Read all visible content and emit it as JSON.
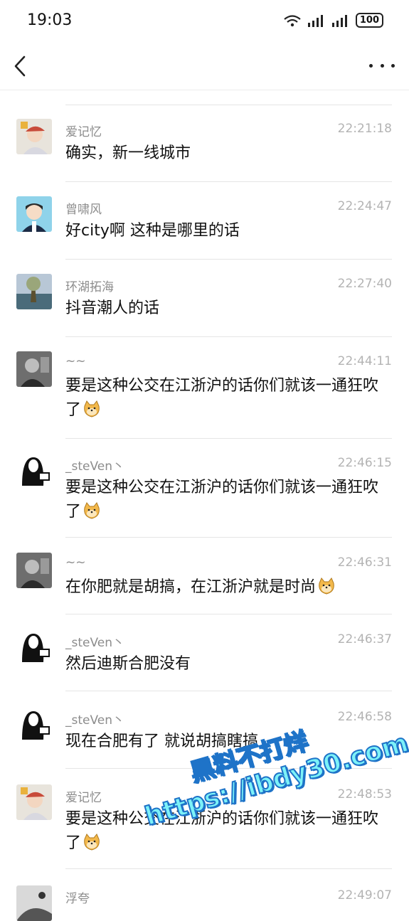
{
  "status_bar": {
    "time": "19:03",
    "battery": "100"
  },
  "nav": {
    "back_icon": "chevron-left-icon",
    "more_icon": "more-dots-icon"
  },
  "messages": [
    {
      "name": "爱记忆",
      "time": "22:21:18",
      "text": "确实，新一线城市",
      "emoji": false
    },
    {
      "name": "曾啸风",
      "time": "22:24:47",
      "text": "好city啊 这种是哪里的话",
      "emoji": false
    },
    {
      "name": "环湖拓海",
      "time": "22:27:40",
      "text": "抖音潮人的话",
      "emoji": false
    },
    {
      "name": "~~",
      "time": "22:44:11",
      "text": "要是这种公交在江浙沪的话你们就该一通狂吹了",
      "emoji": true
    },
    {
      "name": "_steVen丶",
      "time": "22:46:15",
      "text": "要是这种公交在江浙沪的话你们就该一通狂吹了",
      "emoji": true
    },
    {
      "name": "~~",
      "time": "22:46:31",
      "text": "在你肥就是胡搞，在江浙沪就是时尚",
      "emoji": true
    },
    {
      "name": "_steVen丶",
      "time": "22:46:37",
      "text": "然后迪斯合肥没有",
      "emoji": false
    },
    {
      "name": "_steVen丶",
      "time": "22:46:58",
      "text": "现在合肥有了 就说胡搞瞎搞",
      "emoji": false
    },
    {
      "name": "爱记忆",
      "time": "22:48:53",
      "text": "要是这种公交在江浙沪的话你们就该一通狂吹了",
      "emoji": true
    },
    {
      "name": "浮夸",
      "time": "22:49:07",
      "text": "",
      "emoji": false
    }
  ],
  "watermark": {
    "line1": "黑料不打烊",
    "line2": "https://ibdy30.com"
  }
}
